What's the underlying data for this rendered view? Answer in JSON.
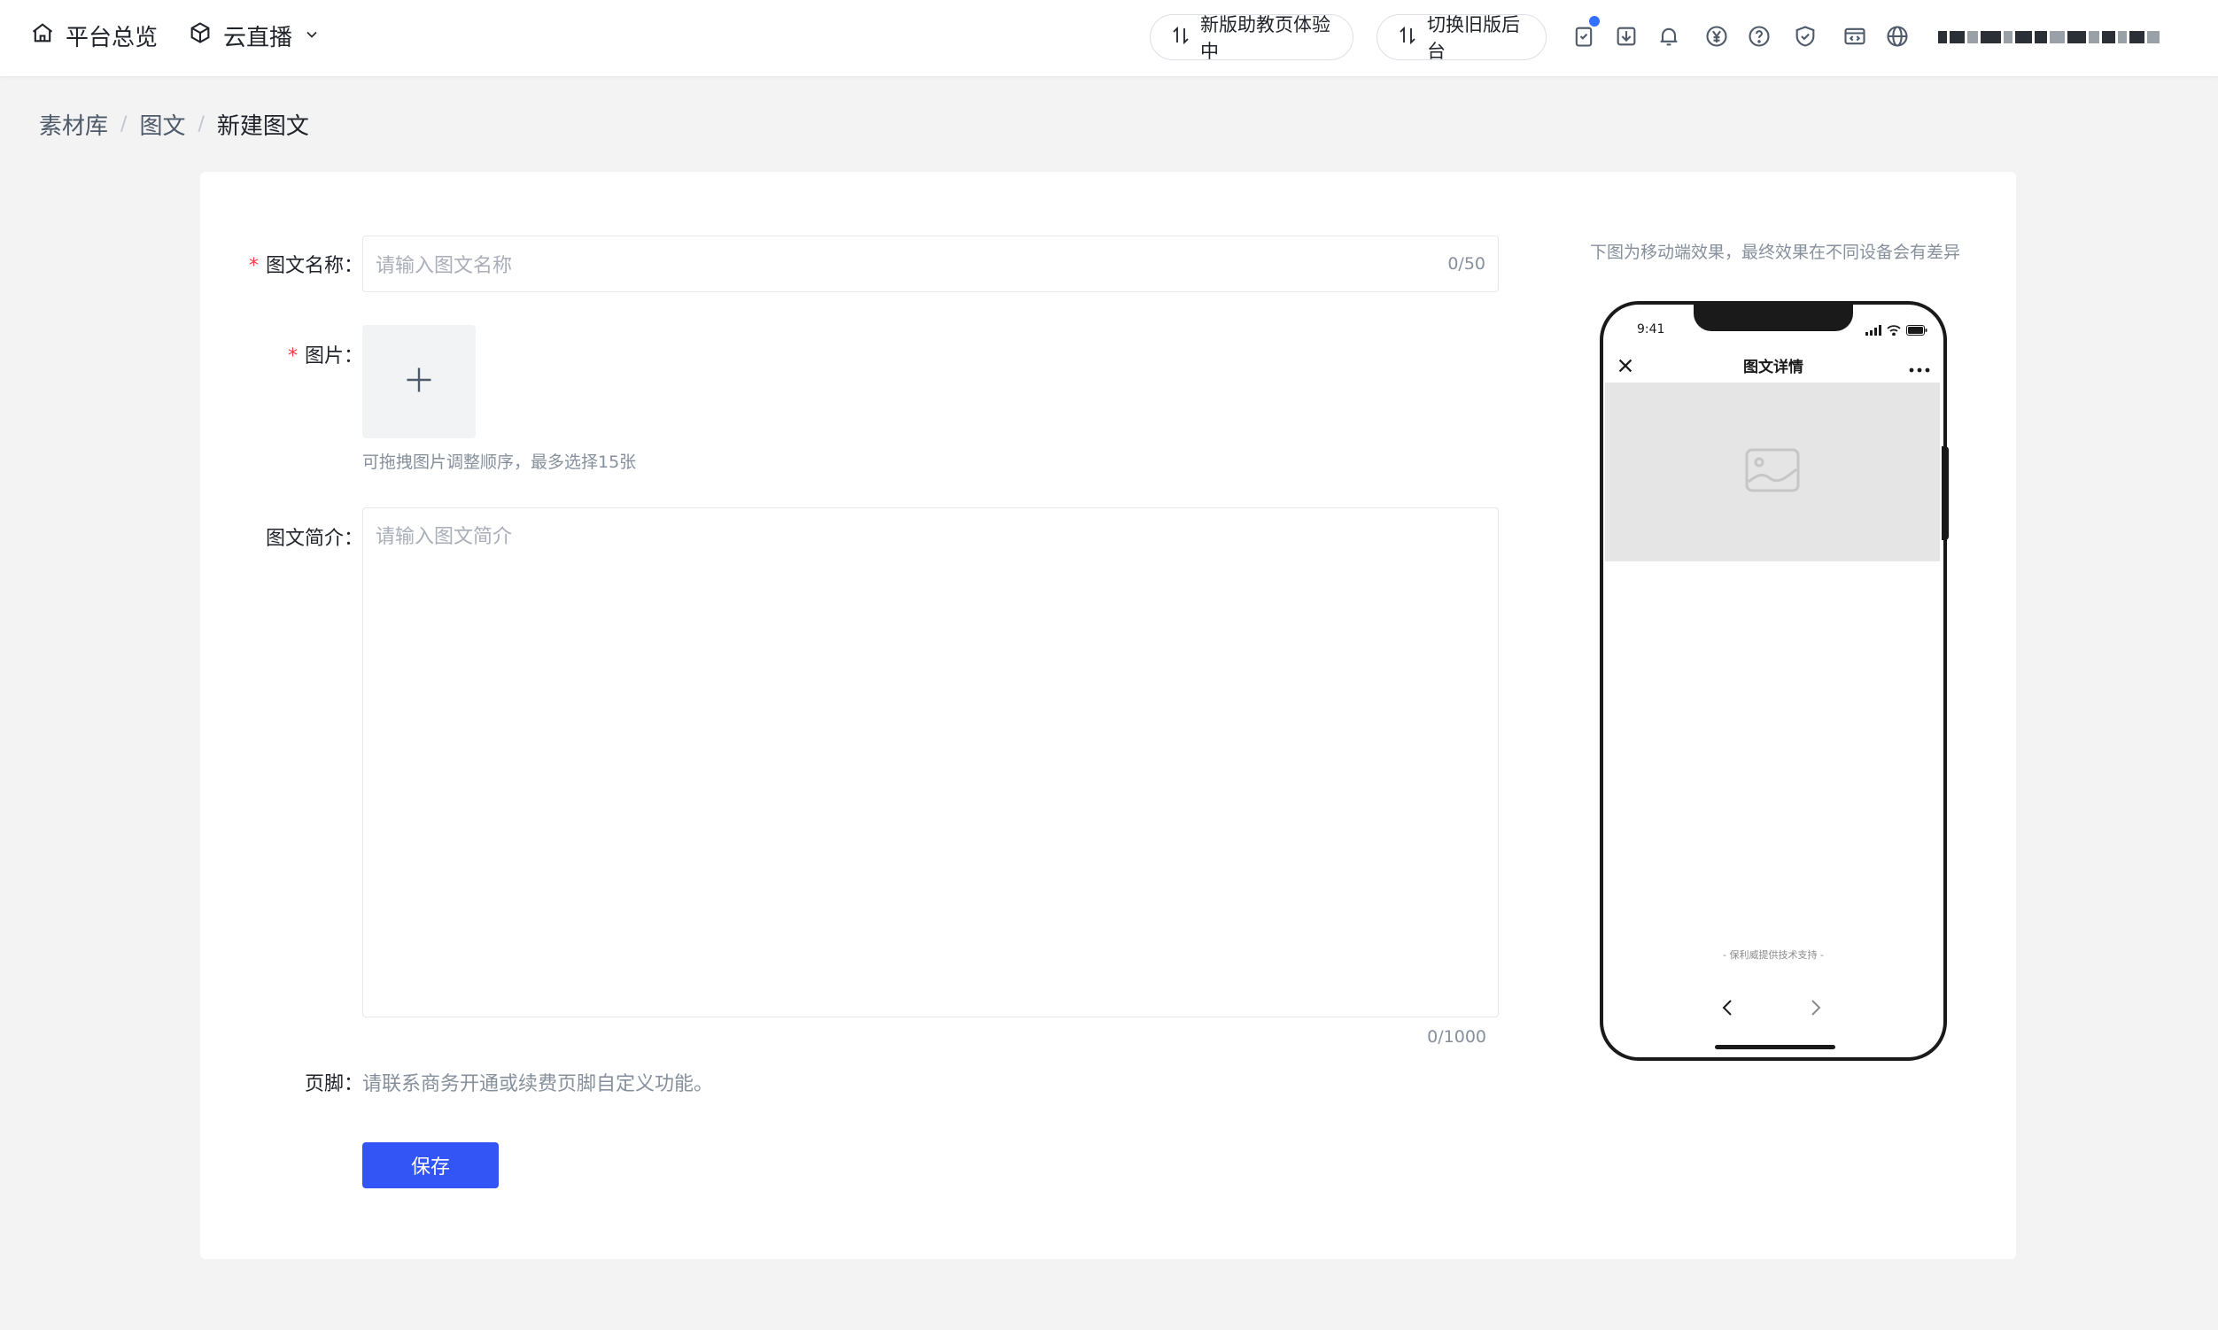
{
  "header": {
    "nav": [
      {
        "label": "平台总览",
        "icon": "home-icon"
      },
      {
        "label": "云直播",
        "icon": "cube-icon"
      }
    ],
    "buttons": [
      {
        "label": "新版助教页体验中",
        "icon": "switch-icon"
      },
      {
        "label": "切换旧版后台",
        "icon": "switch-icon"
      }
    ],
    "tools": [
      "task-icon",
      "download-icon",
      "bell-icon",
      "yen-icon",
      "help-icon",
      "shield-icon",
      "code-window-icon",
      "globe-icon"
    ]
  },
  "breadcrumb": {
    "items": [
      "素材库",
      "图文",
      "新建图文"
    ],
    "separator": "/"
  },
  "form": {
    "name": {
      "label": "图文名称：",
      "placeholder": "请输入图文名称",
      "counter": "0/50"
    },
    "image": {
      "label": "图片：",
      "hint": "可拖拽图片调整顺序，最多选择15张"
    },
    "intro": {
      "label": "图文简介：",
      "placeholder": "请输入图文简介",
      "counter": "0/1000"
    },
    "footer": {
      "label": "页脚：",
      "text": "请联系商务开通或续费页脚自定义功能。"
    },
    "required_mark": "*",
    "save_label": "保存"
  },
  "preview": {
    "note": "下图为移动端效果，最终效果在不同设备会有差异",
    "time": "9:41",
    "title": "图文详情",
    "support": "- 保利威提供技术支持 -"
  },
  "colors": {
    "primary": "#3355f6",
    "required": "#f53f3f",
    "badge": "#3370ff"
  }
}
